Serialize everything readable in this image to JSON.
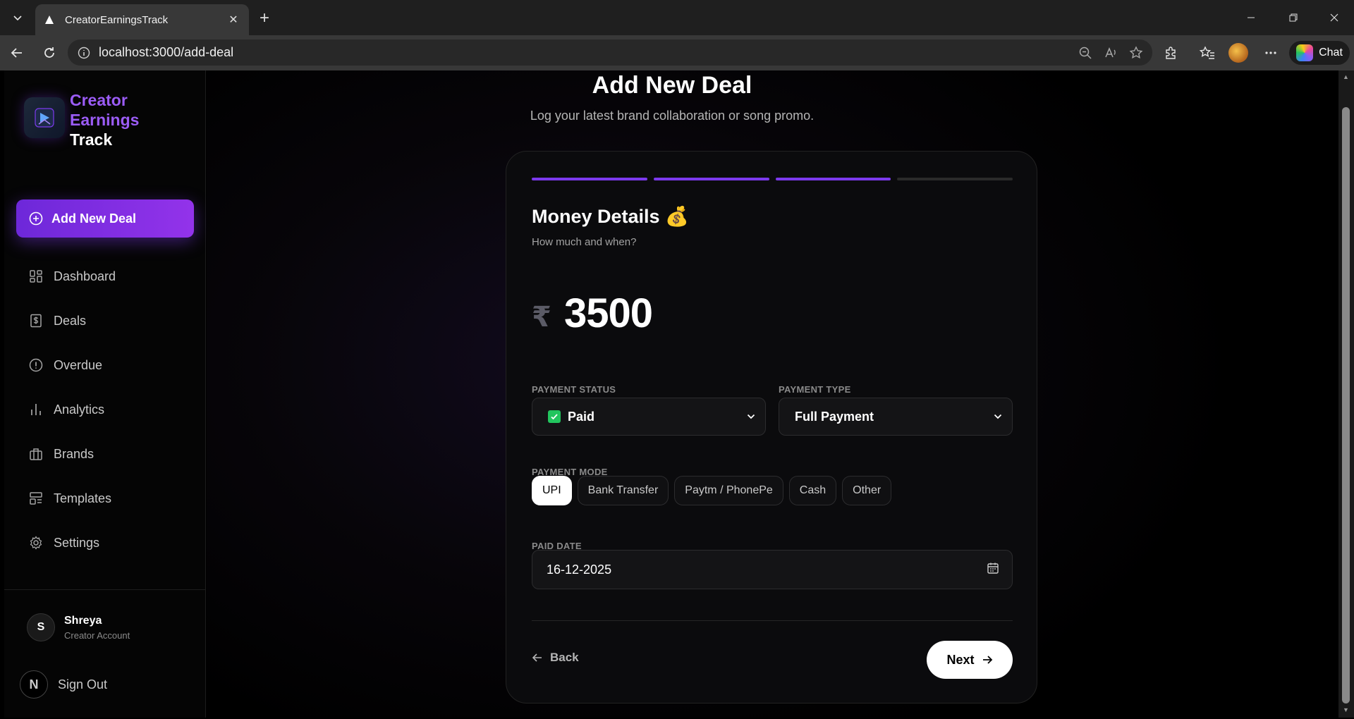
{
  "browser": {
    "tab_title": "CreatorEarningsTrack",
    "url": "localhost:3000/add-deal",
    "chat_label": "Chat"
  },
  "sidebar": {
    "brand": {
      "line1": "Creator",
      "line2": "Earnings",
      "line3": "Track"
    },
    "add_deal_label": "Add New Deal",
    "items": [
      {
        "label": "Dashboard",
        "icon": "dashboard-icon"
      },
      {
        "label": "Deals",
        "icon": "dollar-receipt-icon"
      },
      {
        "label": "Overdue",
        "icon": "alert-circle-icon"
      },
      {
        "label": "Analytics",
        "icon": "bar-chart-icon"
      },
      {
        "label": "Brands",
        "icon": "briefcase-icon"
      },
      {
        "label": "Templates",
        "icon": "layout-icon"
      },
      {
        "label": "Settings",
        "icon": "gear-icon"
      }
    ],
    "user": {
      "initial": "S",
      "name": "Shreya",
      "role": "Creator Account"
    },
    "signout_badge": "N",
    "signout_label": "Sign Out"
  },
  "main": {
    "title": "Add New Deal",
    "subtitle": "Log your latest brand collaboration or song promo.",
    "progress": {
      "steps_total": 4,
      "steps_done": 3
    },
    "step_title": "Money Details 💰",
    "step_subtitle": "How much and when?",
    "currency_symbol": "₹",
    "amount": "3500",
    "payment_status": {
      "label": "PAYMENT STATUS",
      "value": "Paid"
    },
    "payment_type": {
      "label": "PAYMENT TYPE",
      "value": "Full Payment"
    },
    "payment_mode": {
      "label": "PAYMENT MODE",
      "options": [
        "UPI",
        "Bank Transfer",
        "Paytm / PhonePe",
        "Cash",
        "Other"
      ],
      "selected": "UPI"
    },
    "paid_date": {
      "label": "PAID DATE",
      "value": "16-12-2025"
    },
    "back_label": "Back",
    "next_label": "Next"
  },
  "colors": {
    "accent": "#7c3aed",
    "accent_light": "#9b5cf6",
    "success": "#22c55e"
  }
}
